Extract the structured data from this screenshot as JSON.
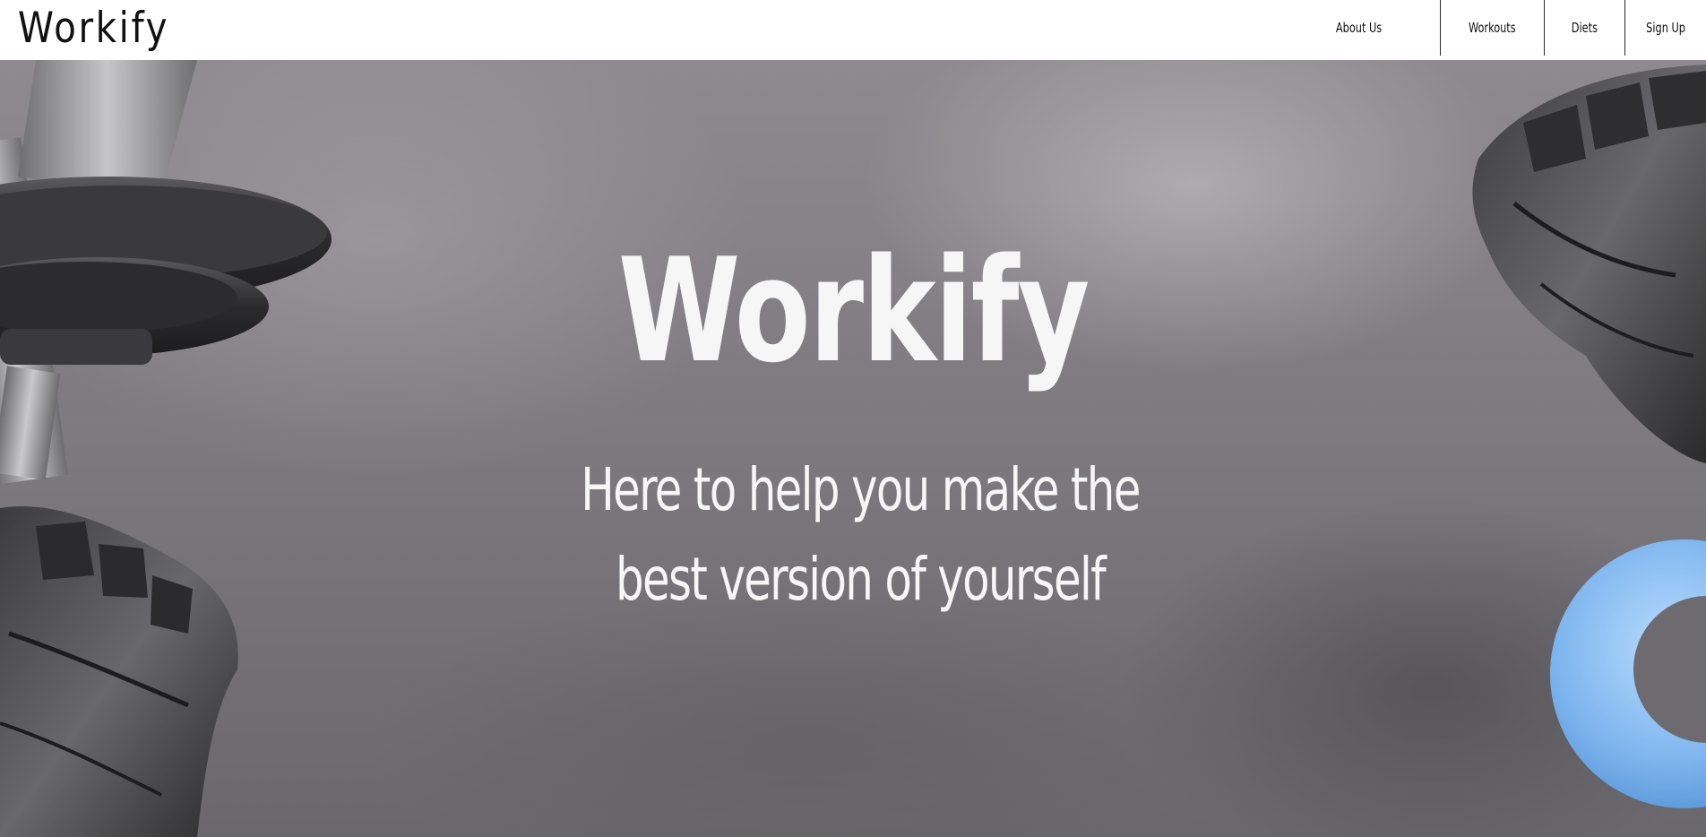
{
  "header": {
    "logo": "Workify",
    "nav": [
      {
        "label": "About Us"
      },
      {
        "label": "Workouts"
      },
      {
        "label": "Diets"
      },
      {
        "label": "Sign Up"
      }
    ]
  },
  "hero": {
    "title": "Workify",
    "subtitle": "Here to help you make the best version of yourself",
    "text_color": "#f6f6f7",
    "accent_ring_color": "#7fb6ee"
  }
}
